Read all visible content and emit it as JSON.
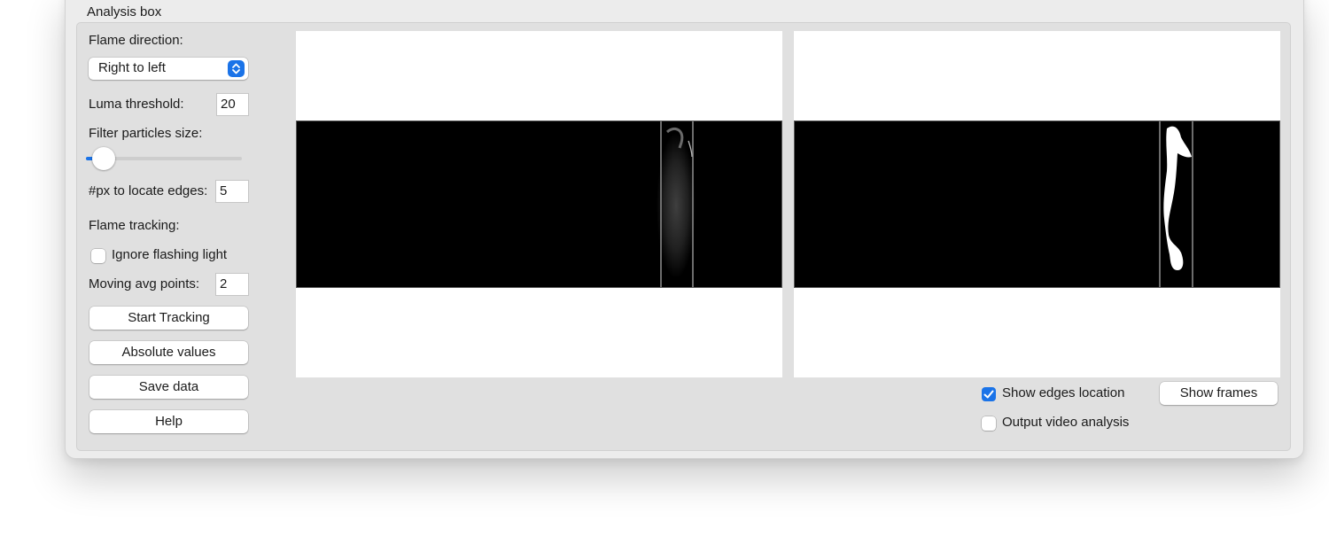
{
  "group": {
    "title": "Analysis box"
  },
  "controls": {
    "flame_direction": {
      "label": "Flame direction:",
      "value": "Right to left"
    },
    "luma_threshold": {
      "label": "Luma threshold:",
      "value": "20"
    },
    "filter_particles": {
      "label": "Filter particles size:",
      "level": 0.05
    },
    "px_edges": {
      "label": "#px to locate edges:",
      "value": "5"
    },
    "flame_tracking_label": "Flame tracking:",
    "ignore_flashing": {
      "label": "Ignore flashing light",
      "checked": false
    },
    "moving_avg": {
      "label": "Moving avg points:",
      "value": "2"
    }
  },
  "buttons": {
    "start_tracking": "Start Tracking",
    "absolute_values": "Absolute values",
    "save_data": "Save data",
    "help": "Help",
    "show_frames": "Show frames"
  },
  "options": {
    "show_edges": {
      "label": "Show edges location",
      "checked": true
    },
    "output_video": {
      "label": "Output video analysis",
      "checked": false
    }
  },
  "colors": {
    "accent": "#1a73e8",
    "panel": "#e0e0e0",
    "window": "#ececec"
  },
  "icons": {
    "select_arrows": "chevron-up-down-icon",
    "checkmark": "checkmark-icon"
  }
}
